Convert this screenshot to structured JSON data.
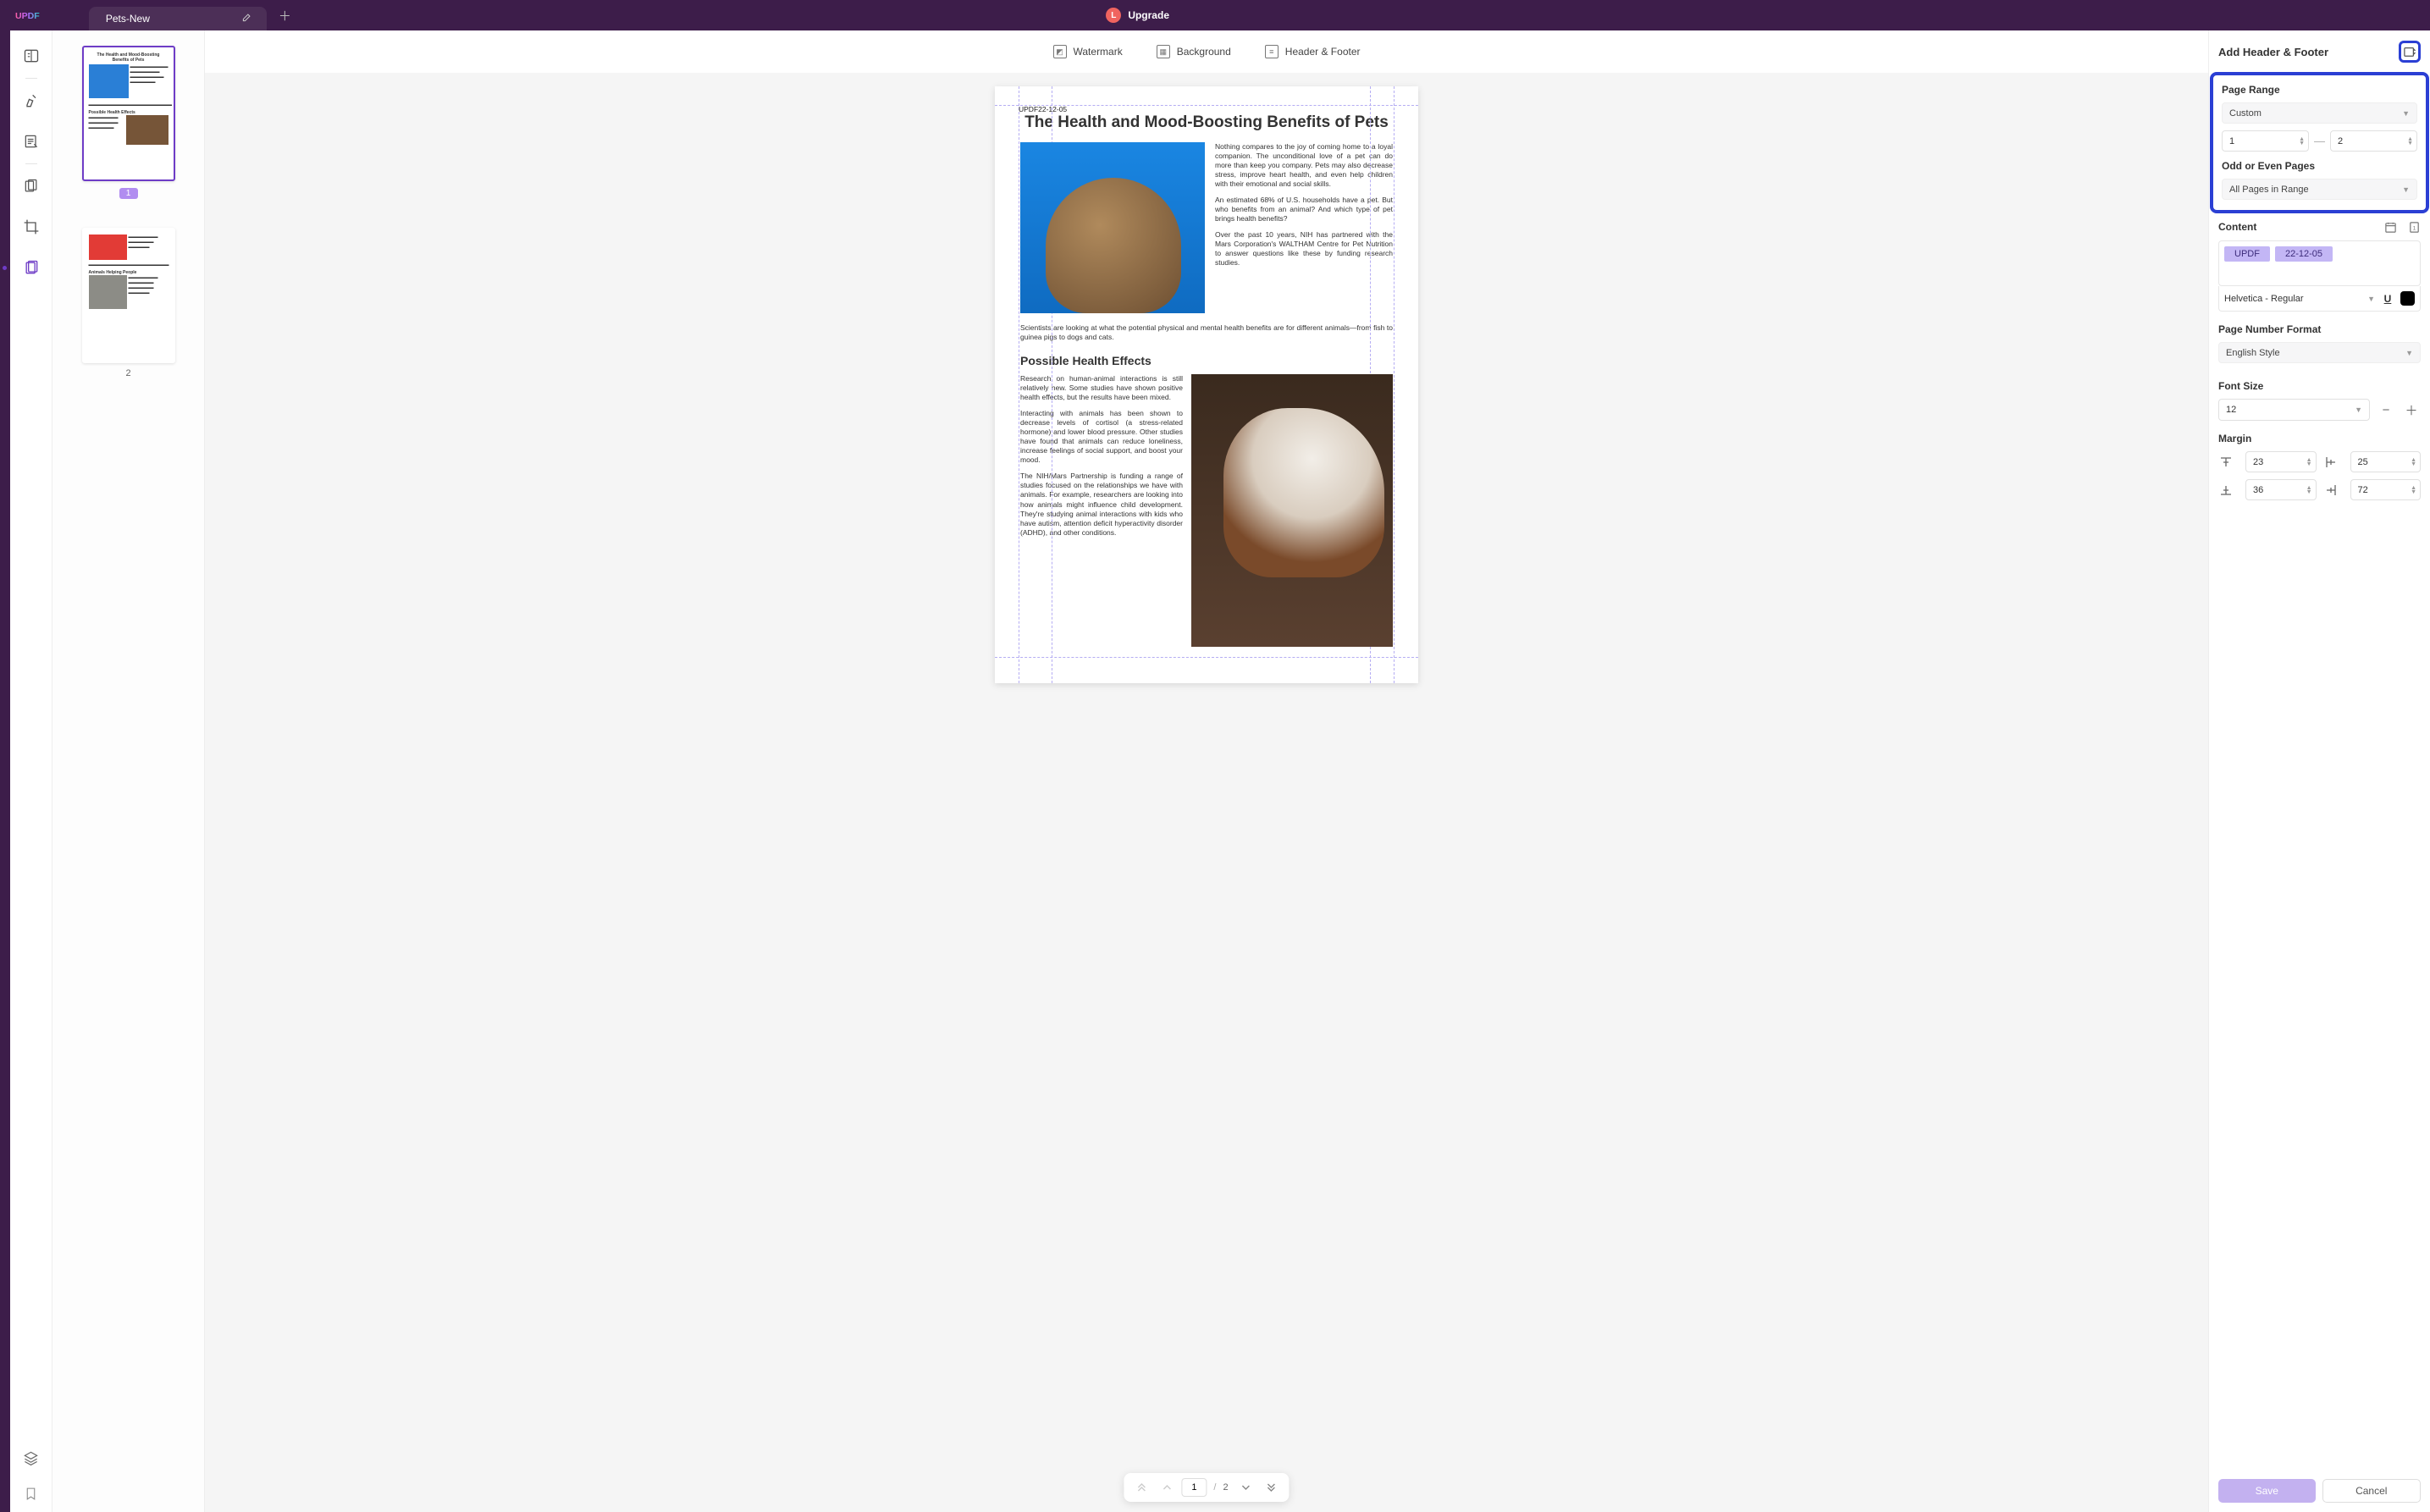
{
  "app": {
    "logo_text": "UPDF",
    "tab_title": "Pets-New",
    "upgrade_label": "Upgrade",
    "avatar_letter": "L"
  },
  "top_tabs": {
    "watermark": "Watermark",
    "background": "Background",
    "header_footer": "Header & Footer"
  },
  "thumbs": {
    "p1": "1",
    "p2": "2"
  },
  "page_nav": {
    "current": "1",
    "total": "2"
  },
  "doc": {
    "header_tag": "UPDF22-12-05",
    "title": "The Health and Mood-Boosting Benefits of Pets",
    "p1": "Nothing compares to the joy of coming home to a loyal companion. The unconditional love of a pet can do more than keep you company. Pets may also decrease stress, improve heart health, and even help children with their emotional and social skills.",
    "p2": "An estimated 68% of U.S. households have a pet. But who benefits from an animal? And which type of pet brings health benefits?",
    "p3": "Over the past 10 years, NIH has partnered with the Mars Corporation's WALTHAM Centre for Pet Nutrition to answer questions like these by funding research studies.",
    "p4": "Scientists are looking at what the potential physical and mental health benefits are for different animals—from fish to guinea pigs to dogs and cats.",
    "h2": "Possible Health Effects",
    "p5": "Research on human-animal interactions is still relatively new. Some studies have shown positive health effects, but the results have been mixed.",
    "p6": "Interacting with animals has been shown to decrease levels of cortisol (a stress-related hormone) and lower blood pressure. Other studies have found that animals can reduce loneliness, increase feelings of social support, and boost your mood.",
    "p7": "The NIH/Mars Partnership is funding a range of studies focused on the relationships we have with animals. For example, researchers are looking into how animals might influence child development. They're studying animal interactions with kids who have autism, attention deficit hyperactivity disorder (ADHD), and other conditions."
  },
  "panel": {
    "title": "Add Header & Footer",
    "page_range_label": "Page Range",
    "page_range_select": "Custom",
    "range_from": "1",
    "range_to": "2",
    "odd_even_label": "Odd or Even Pages",
    "odd_even_select": "All Pages in Range",
    "content_label": "Content",
    "chip1": "UPDF",
    "chip2": "22-12-05",
    "font_name": "Helvetica - Regular",
    "page_num_fmt_label": "Page Number Format",
    "page_num_fmt": "English Style",
    "font_size_label": "Font Size",
    "font_size": "12",
    "margin_label": "Margin",
    "margin_top": "23",
    "margin_left": "25",
    "margin_bottom": "36",
    "margin_right": "72",
    "save": "Save",
    "cancel": "Cancel"
  }
}
